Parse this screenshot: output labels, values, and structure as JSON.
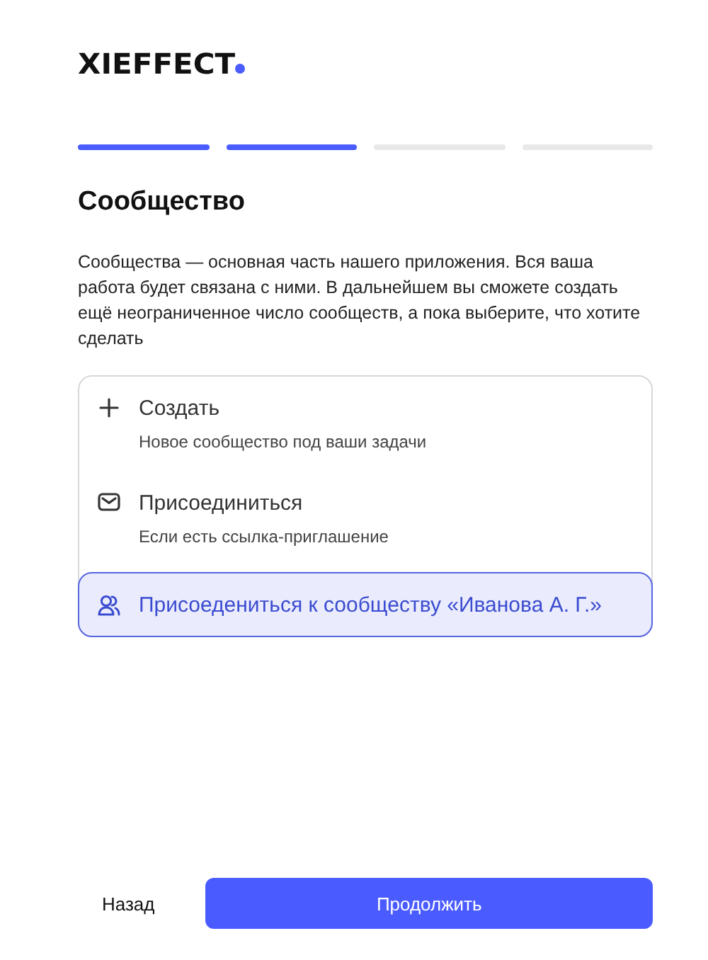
{
  "logo": {
    "text": "XIEFFECT"
  },
  "steps": [
    {
      "done": true
    },
    {
      "done": true
    },
    {
      "done": false
    },
    {
      "done": false
    }
  ],
  "title": "Сообщество",
  "description": "Сообщества — основная часть нашего приложения. Вся ваша работа будет связана с ними. В дальнейшем вы сможете создать ещё неограниченное число сообществ, а пока выберите, что хотите сделать",
  "options": [
    {
      "kind": "plus",
      "title": "Создать",
      "subtitle": "Новое сообщество под ваши задачи",
      "selected": false
    },
    {
      "kind": "mail",
      "title": "Присоединиться",
      "subtitle": "Если есть ссылка-приглашение",
      "selected": false
    },
    {
      "kind": "users",
      "title": "Присоедениться к сообществу «Иванова А. Г.»",
      "selected": true
    }
  ],
  "buttons": {
    "back": "Назад",
    "next": "Продолжить"
  }
}
